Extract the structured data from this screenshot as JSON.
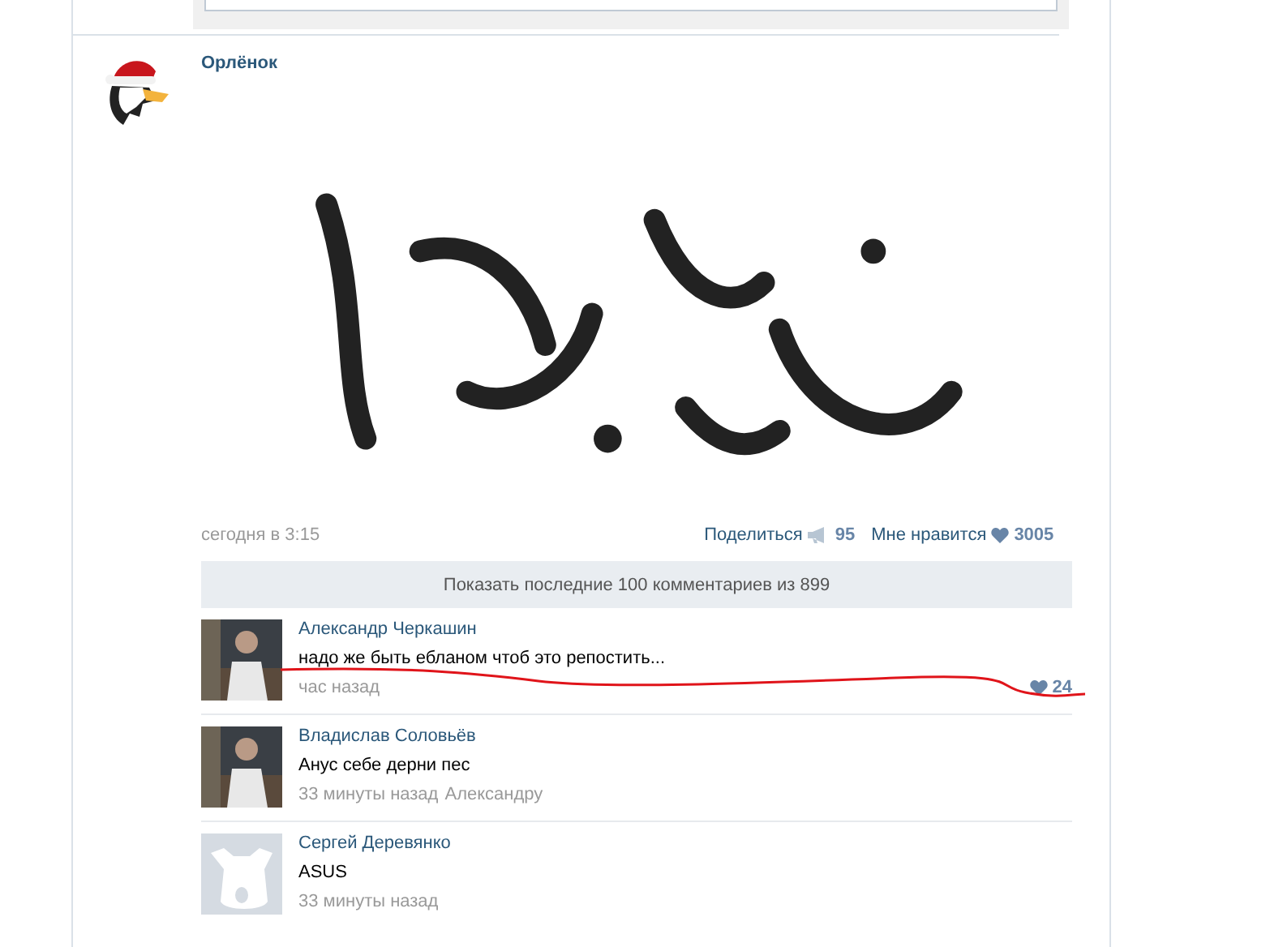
{
  "post": {
    "author": "Орлёнок",
    "time": "сегодня в 3:15",
    "share": {
      "label": "Поделиться",
      "count": "95"
    },
    "like": {
      "label": "Мне нравится",
      "count": "3005"
    }
  },
  "show_more": "Показать последние 100 комментариев из 899",
  "comments": [
    {
      "author": "Александр Черкашин",
      "text": "надо же быть ебланом чтоб это репостить...",
      "time": "час назад",
      "likes": "24"
    },
    {
      "author": "Владислав Соловьёв",
      "text": "Анус себе дерни пес",
      "time": "33 минуты назад",
      "reply_to": "Александру"
    },
    {
      "kind": "placeholder",
      "author": "Сергей Деревянко",
      "text": "ASUS",
      "time": "33 минуты назад"
    }
  ]
}
